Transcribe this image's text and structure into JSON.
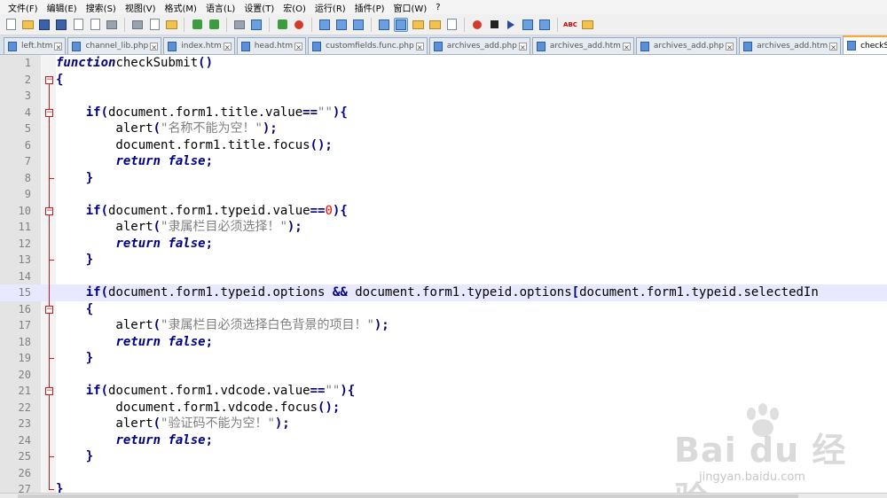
{
  "menu": [
    "文件(F)",
    "编辑(E)",
    "搜索(S)",
    "视图(V)",
    "格式(M)",
    "语言(L)",
    "设置(T)",
    "宏(O)",
    "运行(R)",
    "插件(P)",
    "窗口(W)",
    "?"
  ],
  "toolbar": {
    "icons": [
      "new-file-icon",
      "open-icon",
      "save-icon",
      "save-all-icon",
      "close-icon",
      "close-all-icon",
      "print-icon",
      "cut-icon",
      "copy-icon",
      "paste-icon",
      "undo-icon",
      "redo-icon",
      "find-icon",
      "replace-icon",
      "zoom-in-icon",
      "zoom-out-icon",
      "sync-vertical-icon",
      "sync-horizontal-icon",
      "word-wrap-icon",
      "show-all-chars-icon",
      "indent-guide-icon",
      "folder-as-workspace-icon",
      "document-map-icon",
      "function-list-icon",
      "record-macro-icon",
      "stop-macro-icon",
      "play-macro-icon",
      "run-macro-multiple-icon",
      "save-macro-icon",
      "spell-check-icon",
      "plugin-icon"
    ],
    "active_icon": "indent-guide-icon"
  },
  "tabs": [
    {
      "label": "left.htm",
      "active": false
    },
    {
      "label": "channel_lib.php",
      "active": false
    },
    {
      "label": "index.htm",
      "active": false
    },
    {
      "label": "head.htm",
      "active": false
    },
    {
      "label": "customfields.func.php",
      "active": false
    },
    {
      "label": "archives_add.php",
      "active": false
    },
    {
      "label": "archives_add.htm",
      "active": false
    },
    {
      "label": "archives_add.php",
      "active": false
    },
    {
      "label": "archives_add.htm",
      "active": false
    },
    {
      "label": "checkSubmit",
      "active": true
    }
  ],
  "editor": {
    "current_line": 15,
    "lines": [
      [
        [
          "kw-i",
          "function"
        ],
        [
          "",
          "checkSubmit"
        ],
        [
          "op",
          "()"
        ]
      ],
      [
        [
          "op",
          "{"
        ]
      ],
      [],
      [
        [
          "",
          "    "
        ],
        [
          "kw",
          "if"
        ],
        [
          "op",
          "("
        ],
        [
          "",
          "document.form1.title.value"
        ],
        [
          "op",
          "=="
        ],
        [
          "str",
          "\"\""
        ],
        [
          "op",
          "){"
        ]
      ],
      [
        [
          "",
          "        alert"
        ],
        [
          "op",
          "("
        ],
        [
          "str",
          "\"名称不能为空！\""
        ],
        [
          "op",
          ");"
        ]
      ],
      [
        [
          "",
          "        document.form1.title.focus"
        ],
        [
          "op",
          "();"
        ]
      ],
      [
        [
          "",
          "        "
        ],
        [
          "kw-i",
          "return"
        ],
        [
          "",
          ""
        ],
        [
          "kw-i",
          " false"
        ],
        [
          "op",
          ";"
        ]
      ],
      [
        [
          "",
          "    "
        ],
        [
          "op",
          "}"
        ]
      ],
      [],
      [
        [
          "",
          "    "
        ],
        [
          "kw",
          "if"
        ],
        [
          "op",
          "("
        ],
        [
          "",
          "document.form1.typeid.value"
        ],
        [
          "op",
          "=="
        ],
        [
          "num",
          "0"
        ],
        [
          "op",
          "){"
        ]
      ],
      [
        [
          "",
          "        alert"
        ],
        [
          "op",
          "("
        ],
        [
          "str",
          "\"隶属栏目必须选择！\""
        ],
        [
          "op",
          ");"
        ]
      ],
      [
        [
          "",
          "        "
        ],
        [
          "kw-i",
          "return"
        ],
        [
          "kw-i",
          " false"
        ],
        [
          "op",
          ";"
        ]
      ],
      [
        [
          "",
          "    "
        ],
        [
          "op",
          "}"
        ]
      ],
      [],
      [
        [
          "",
          "    "
        ],
        [
          "kw",
          "if"
        ],
        [
          "op",
          "("
        ],
        [
          "",
          "document.form1.typeid.options "
        ],
        [
          "op",
          "&&"
        ],
        [
          "",
          ""
        ],
        [
          "",
          ""
        ],
        [
          "",
          "document.form1.typeid.options"
        ],
        [
          "op",
          "["
        ],
        [
          "",
          "document.form1.typeid.selectedIn"
        ]
      ],
      [
        [
          "",
          "    "
        ],
        [
          "op",
          "{"
        ]
      ],
      [
        [
          "",
          "        alert"
        ],
        [
          "op",
          "("
        ],
        [
          "str",
          "\"隶属栏目必须选择白色背景的项目！\""
        ],
        [
          "op",
          ");"
        ]
      ],
      [
        [
          "",
          "        "
        ],
        [
          "kw-i",
          "return"
        ],
        [
          "kw-i",
          " false"
        ],
        [
          "op",
          ";"
        ]
      ],
      [
        [
          "",
          "    "
        ],
        [
          "op",
          "}"
        ]
      ],
      [],
      [
        [
          "",
          "    "
        ],
        [
          "kw",
          "if"
        ],
        [
          "op",
          "("
        ],
        [
          "",
          "document.form1.vdcode.value"
        ],
        [
          "op",
          "=="
        ],
        [
          "str",
          "\"\""
        ],
        [
          "op",
          "){"
        ]
      ],
      [
        [
          "",
          "        document.form1.vdcode.focus"
        ],
        [
          "op",
          "();"
        ]
      ],
      [
        [
          "",
          "        alert"
        ],
        [
          "op",
          "("
        ],
        [
          "str",
          "\"验证码不能为空！\""
        ],
        [
          "op",
          ");"
        ]
      ],
      [
        [
          "",
          "        "
        ],
        [
          "kw-i",
          "return"
        ],
        [
          "kw-i",
          " false"
        ],
        [
          "op",
          ";"
        ]
      ],
      [
        [
          "",
          "    "
        ],
        [
          "op",
          "}"
        ]
      ],
      [],
      [
        [
          "op",
          "}"
        ]
      ]
    ]
  },
  "watermark": {
    "brand": "Bai du 经验",
    "url": "jingyan.baidu.com"
  }
}
